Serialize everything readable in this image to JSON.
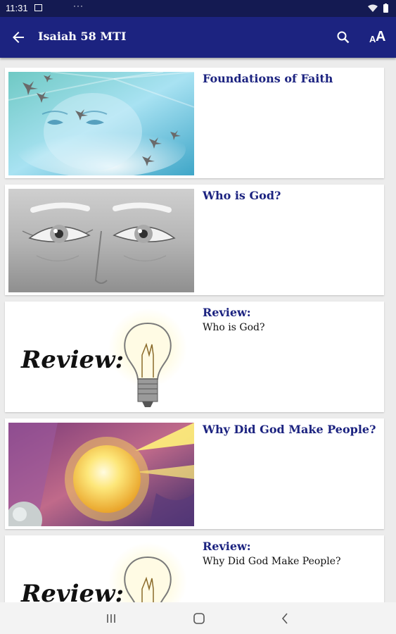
{
  "status_bar": {
    "time": "11:31",
    "left_icons": [
      "photo-icon",
      "more-dots-icon"
    ],
    "right_icons": [
      "wifi-icon",
      "battery-icon"
    ]
  },
  "app_bar": {
    "title": "Isaiah 58 MTI",
    "icons": [
      "back-arrow-icon",
      "search-icon",
      "text-size-icon"
    ],
    "text_size_small": "A",
    "text_size_large": "A",
    "background_color": "#1c2380"
  },
  "lessons": [
    {
      "title": "Foundations of Faith",
      "subtitle": "",
      "image": "face-in-sky-with-birds"
    },
    {
      "title": "Who is God?",
      "subtitle": "",
      "image": "pencil-drawing-of-eyes"
    },
    {
      "title": "Review:",
      "subtitle": "Who is God?",
      "image": "review-light-bulb",
      "image_text": "Review:"
    },
    {
      "title": "Why Did God Make People?",
      "subtitle": "",
      "image": "bright-light-sphere"
    },
    {
      "title": "Review:",
      "subtitle": "Why Did God Make People?",
      "image": "review-light-bulb",
      "image_text": "Review:"
    }
  ],
  "navigation_bar": {
    "buttons": [
      "recent-apps-icon",
      "home-icon",
      "back-icon"
    ]
  },
  "colors": {
    "title_text": "#1c2380",
    "status_bar": "#141a52",
    "card_background": "#ffffff",
    "page_background": "#ececec"
  }
}
